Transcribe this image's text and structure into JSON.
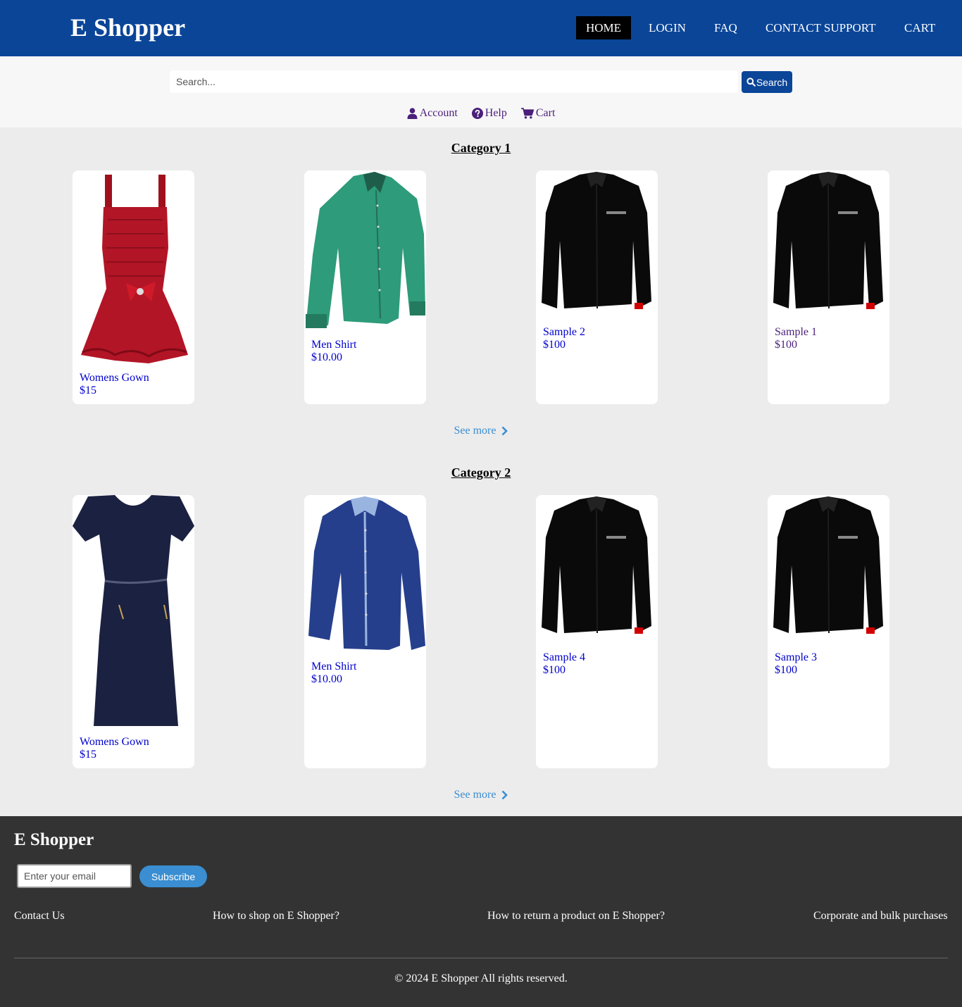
{
  "header": {
    "brand": "E Shopper",
    "nav": [
      "HOME",
      "LOGIN",
      "FAQ",
      "CONTACT SUPPORT",
      "CART"
    ],
    "active": "HOME"
  },
  "search": {
    "placeholder": "Search...",
    "button_label": "Search"
  },
  "quick_links": [
    "Account",
    "Help",
    "Cart"
  ],
  "categories": [
    {
      "title": "Category 1",
      "products": [
        {
          "name": "Womens Gown",
          "price": "$15",
          "image": "red-dress"
        },
        {
          "name": "Men Shirt",
          "price": "$10.00",
          "image": "green-shirt"
        },
        {
          "name": "Sample 2",
          "price": "$100",
          "image": "black-shirt"
        },
        {
          "name": "Sample 1",
          "price": "$100",
          "image": "black-shirt"
        }
      ],
      "see_more": "See more"
    },
    {
      "title": "Category 2",
      "products": [
        {
          "name": "Womens Gown",
          "price": "$15",
          "image": "navy-dress"
        },
        {
          "name": "Men Shirt",
          "price": "$10.00",
          "image": "blue-shirt"
        },
        {
          "name": "Sample 4",
          "price": "$100",
          "image": "black-shirt"
        },
        {
          "name": "Sample 3",
          "price": "$100",
          "image": "black-shirt"
        }
      ],
      "see_more": "See more"
    }
  ],
  "footer": {
    "brand": "E Shopper",
    "email_placeholder": "Enter your email",
    "subscribe_label": "Subscribe",
    "links": [
      "Contact Us",
      "How to shop on E Shopper?",
      "How to return a product on E Shopper?",
      "Corporate and bulk purchases"
    ],
    "copyright": "© 2024 E Shopper All rights reserved."
  },
  "colors": {
    "brand_blue": "#0a4598",
    "link_blue": "#0000cc",
    "accent": "#3a8ed1",
    "footer_bg": "#333333"
  }
}
